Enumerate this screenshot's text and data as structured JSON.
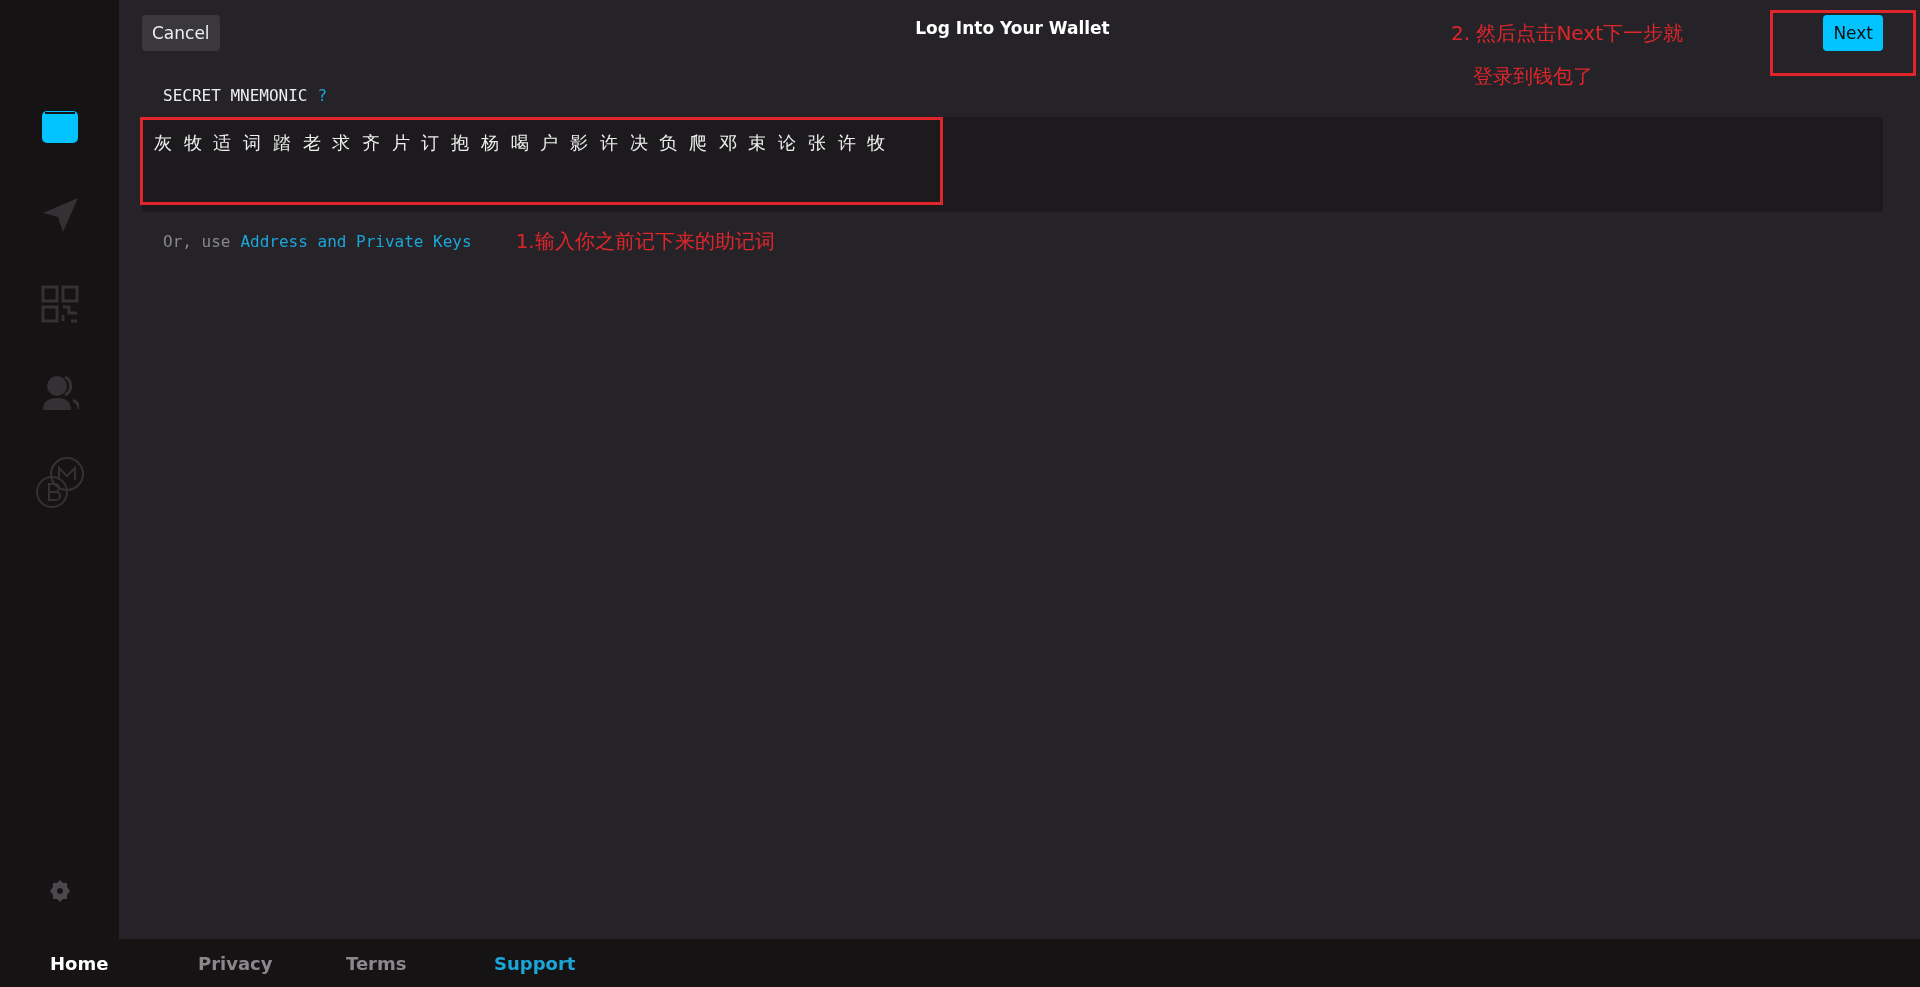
{
  "header": {
    "cancel": "Cancel",
    "title": "Log Into Your Wallet",
    "next": "Next"
  },
  "sidebar": {
    "items": [
      {
        "kind": "wallet",
        "selected": true
      },
      {
        "kind": "send",
        "selected": false
      },
      {
        "kind": "receive",
        "selected": false
      },
      {
        "kind": "contacts",
        "selected": false
      },
      {
        "kind": "exchange",
        "selected": false
      }
    ]
  },
  "form": {
    "label": "SECRET MNEMONIC",
    "help": "?",
    "mnemonic": "灰 牧 适 词 踏 老 求 齐 片 订 抱 杨 喝 户 影 许 决 负 爬 邓 束 论 张 许 牧",
    "alt_prefix": "Or, use",
    "alt_link": "Address and Private Keys"
  },
  "annotations": [
    "1.输入你之前记下来的助记词",
    "2. 然后点击Next下一步就",
    "登录到钱包了"
  ],
  "footer": [
    {
      "label": "Home",
      "selected": true,
      "kind": "nav"
    },
    {
      "label": "Privacy",
      "selected": false,
      "kind": "nav"
    },
    {
      "label": "Terms",
      "selected": false,
      "kind": "nav"
    },
    {
      "label": "Support",
      "selected": false,
      "kind": "accent"
    }
  ]
}
